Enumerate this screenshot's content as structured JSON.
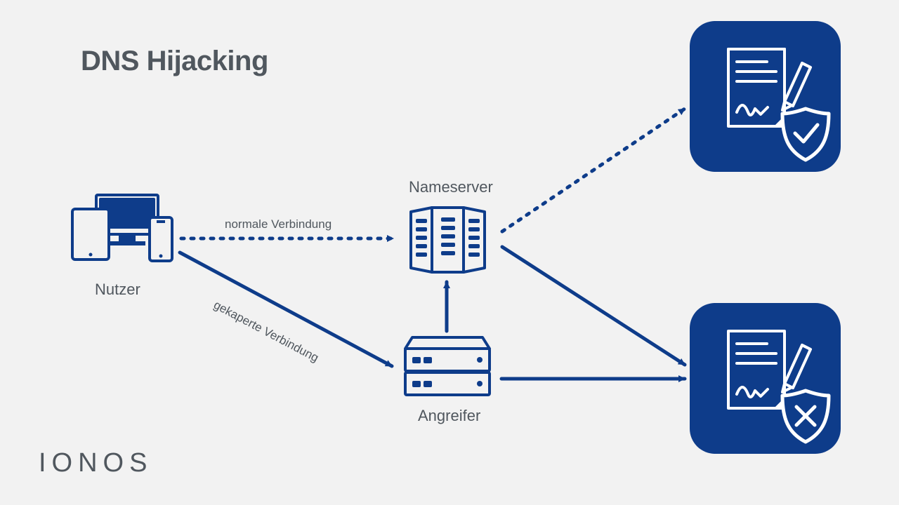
{
  "title": "DNS Hijacking",
  "labels": {
    "user": "Nutzer",
    "nameserver": "Nameserver",
    "attacker": "Angreifer"
  },
  "edges": {
    "normal": "normale Verbindung",
    "hijacked": "gekaperte Verbindung"
  },
  "brand": "IONOS",
  "colors": {
    "primary": "#0e3c8a",
    "text": "#50575e",
    "bg": "#f2f2f2"
  }
}
